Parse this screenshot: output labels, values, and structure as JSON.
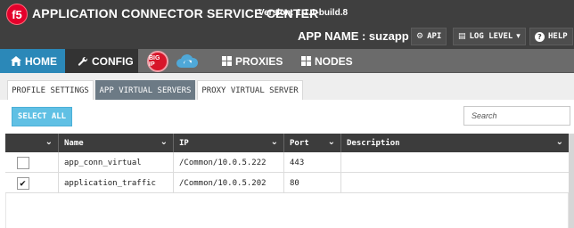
{
  "header": {
    "logo_text": "f5",
    "title": "APPLICATION CONNECTOR SERVICE CENTER",
    "version": "Version: 1.1.1-build.8",
    "app_name": "APP NAME : suzapp",
    "buttons": [
      {
        "label": "API",
        "icon": "gear-icon"
      },
      {
        "label": "LOG LEVEL",
        "icon": "log-icon"
      },
      {
        "label": "HELP",
        "icon": "question-icon"
      }
    ]
  },
  "nav": {
    "home": {
      "label": "HOME",
      "icon": "home-icon"
    },
    "config": {
      "label": "CONFIG",
      "icon": "wrench-icon"
    },
    "bigip_badge": "BIG IP",
    "proxies": {
      "label": "PROXIES",
      "icon": "grid-icon"
    },
    "nodes": {
      "label": "NODES",
      "icon": "grid-icon"
    },
    "colors": {
      "home_active": "#2b88b8",
      "config_selected": "#333333",
      "bar": "#6b6b6b"
    }
  },
  "subtabs": [
    {
      "label": "PROFILE SETTINGS",
      "active": false
    },
    {
      "label": "APP VIRTUAL SERVERS",
      "active": true
    },
    {
      "label": "PROXY VIRTUAL SERVER",
      "active": false
    }
  ],
  "toolbar": {
    "select_all": "SELECT ALL",
    "search_placeholder": "Search"
  },
  "table": {
    "columns": [
      "Name",
      "IP",
      "Port",
      "Description"
    ],
    "rows": [
      {
        "checked": false,
        "name": "app_conn_virtual",
        "ip": "/Common/10.0.5.222",
        "port": "443",
        "description": ""
      },
      {
        "checked": true,
        "name": "application_traffic",
        "ip": "/Common/10.0.5.202",
        "port": "80",
        "description": ""
      }
    ]
  }
}
